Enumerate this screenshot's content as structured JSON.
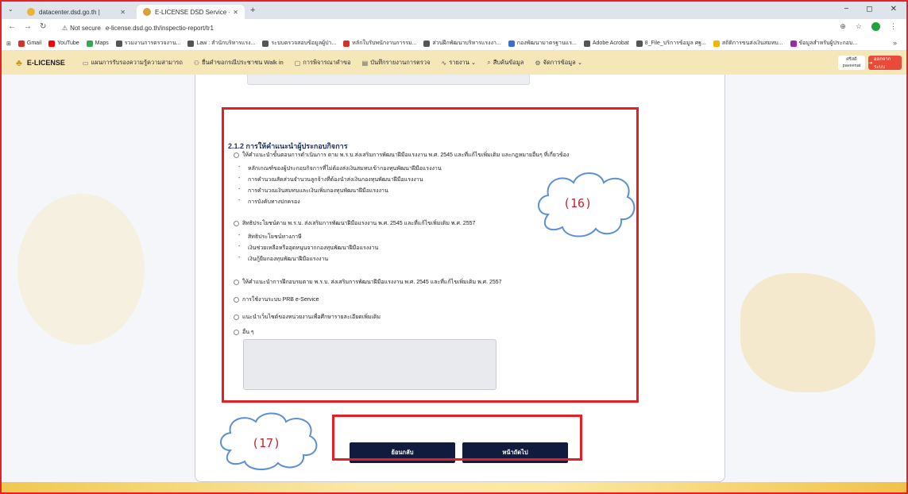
{
  "browser": {
    "tabs": [
      {
        "title": "datacenter.dsd.go.th |",
        "active": false
      },
      {
        "title": "E-LICENSE DSD Service - ระบบใบ",
        "active": true
      }
    ],
    "new_tab": "+",
    "window_controls": [
      "−",
      "◻",
      "✕"
    ],
    "security_label": "Not secure",
    "url": "e-license.dsd.go.th/inspectio-report/tr1",
    "bookmarks": [
      {
        "label": "Gmail",
        "color": "#d93025"
      },
      {
        "label": "YouTube",
        "color": "#ff0000"
      },
      {
        "label": "Maps",
        "color": "#34a853"
      },
      {
        "label": "รวมงานการตรวจงาน...",
        "color": "#555555"
      },
      {
        "label": "Law : สำนักบริหารแรง...",
        "color": "#555555"
      },
      {
        "label": "ระบบตรวจสอบข้อมูลผู้ป่า...",
        "color": "#555555"
      },
      {
        "label": "หลักใบรับพนักงานการรม...",
        "color": "#d93025"
      },
      {
        "label": "ส่วนฝึกพัฒนาบริหารแรงงา...",
        "color": "#555555"
      },
      {
        "label": "กองพัฒนามาตรฐานแร...",
        "color": "#3b6fd6"
      },
      {
        "label": "Adobe Acrobat",
        "color": "#555555"
      },
      {
        "label": "8_File_บริการข้อมูล ศฐ...",
        "color": "#555555"
      },
      {
        "label": "สถิติการขนส่งเงินสมทบ...",
        "color": "#f2b705"
      },
      {
        "label": "ข้อมูลสำหรับผู้ประกอบ...",
        "color": "#9c27b0"
      }
    ],
    "bookmarks_more": "»"
  },
  "app": {
    "brand": "E-LICENSE",
    "nav": [
      {
        "icon": "▭",
        "label": "แผนการรับรองความรู้ความสามารถ"
      },
      {
        "icon": "⚇",
        "label": "ยื่นคำขอกรณีประชาชน Walk in"
      },
      {
        "icon": "▢",
        "label": "การพิจารณาคำขอ"
      },
      {
        "icon": "▤",
        "label": "บันทึกรายงานการตรวจ"
      },
      {
        "icon": "∿",
        "label": "รายงาน ⌄"
      },
      {
        "icon": "⌕",
        "label": "สืบค้นข้อมูล"
      },
      {
        "icon": "⚙",
        "label": "จัดการข้อมูล ⌄"
      }
    ],
    "user_line1": "ศรีสดี",
    "user_line2": "paveenat",
    "logout": "ออกจากระบบ"
  },
  "form": {
    "section_title": "2.1.2 การให้คำแนะนำผู้ประกอบกิจการ",
    "options": [
      {
        "label": "ให้คำแนะนำขั้นตอนการดำเนินการ ตาม พ.ร.บ.ส่งเสริมการพัฒนาฝีมือแรงงาน พ.ศ. 2545 และที่แก้ไขเพิ่มเติม และกฎหมายอื่นๆ ที่เกี่ยวข้อง"
      },
      {
        "label": "สิทธิประโยชน์ตาม พ.ร.บ. ส่งเสริมการพัฒนาฝีมือแรงงาน พ.ศ. 2545 และที่แก้ไขเพิ่มเติม พ.ศ. 2557"
      },
      {
        "label": "ให้คำแนะนำการฝึกอบรมตาม พ.ร.บ. ส่งเสริมการพัฒนาฝีมือแรงงาน พ.ศ. 2545 และที่แก้ไขเพิ่มเติม พ.ศ. 2557"
      },
      {
        "label": "การใช้งานระบบ PRB e-Service"
      },
      {
        "label": "แนะนำเว็บไซต์ของหน่วยงานเพื่อศึกษารายละเอียดเพิ่มเติม"
      },
      {
        "label": "อื่น ๆ"
      }
    ],
    "sub_items_1": [
      "หลักเกณฑ์ของผู้ประกอบกิจการที่ไม่ต้องส่งเงินสมทบเข้ากองทุนพัฒนาฝีมือแรงงาน",
      "การคำนวณสัดส่วนจำนวนลูกจ้างที่ต้องนำส่งเงินกองทุนพัฒนาฝีมือแรงงาน",
      "การคำนวณเงินสมทบและเงินเพิ่มกองทุนพัฒนาฝีมือแรงงาน",
      "การบังคับทางปกครอง"
    ],
    "sub_items_2": [
      "สิทธิประโยชน์ทางภาษี",
      "เงินช่วยเหลือหรืออุดหนุนจากกองทุนพัฒนาฝีมือแรงงาน",
      "เงินกู้ยืมกองทุนพัฒนาฝีมือแรงงาน"
    ],
    "back_button": "ย้อนกลับ",
    "next_button": "หน้าถัดไป"
  },
  "annotations": {
    "callout_16": "(16)",
    "callout_17": "(17)",
    "highlight_color": "#e61e25"
  }
}
